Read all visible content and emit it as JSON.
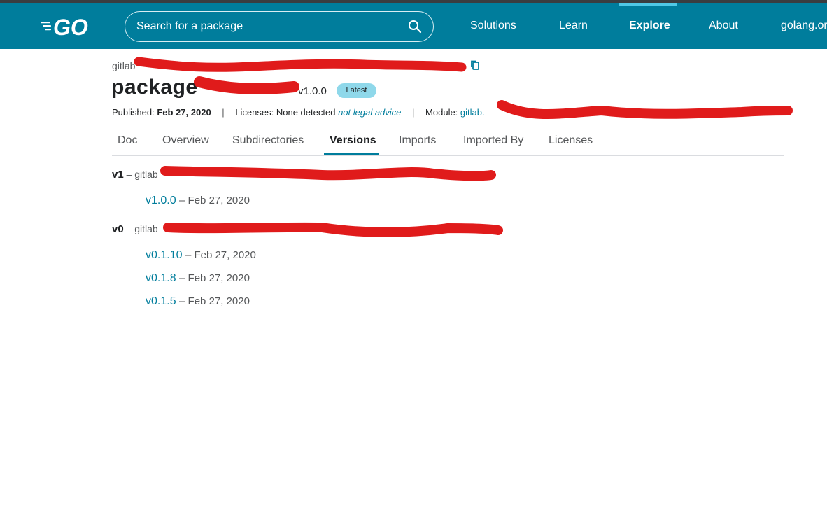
{
  "header": {
    "logo_icon": "go-logo-icon",
    "search": {
      "placeholder": "Search for a package",
      "icon": "search-icon"
    },
    "nav": [
      {
        "label": "Solutions",
        "active": false
      },
      {
        "label": "Learn",
        "active": false
      },
      {
        "label": "Explore",
        "active": true
      },
      {
        "label": "About",
        "active": false
      },
      {
        "label": "golang.or",
        "active": false
      }
    ]
  },
  "package": {
    "breadcrumb": "gitlab",
    "title_prefix": "package",
    "version": "v1.0.0",
    "badge": "Latest",
    "copy_icon": "copy-icon"
  },
  "meta": {
    "published_label": "Published:",
    "published_date": "Feb 27, 2020",
    "licenses_label": "Licenses:",
    "licenses_value": "None detected",
    "licenses_note": "not legal advice",
    "module_label": "Module:",
    "module_value": "gitlab."
  },
  "tabs": [
    {
      "label": "Doc",
      "active": false
    },
    {
      "label": "Overview",
      "active": false
    },
    {
      "label": "Subdirectories",
      "active": false
    },
    {
      "label": "Versions",
      "active": true
    },
    {
      "label": "Imports",
      "active": false
    },
    {
      "label": "Imported By",
      "active": false
    },
    {
      "label": "Licenses",
      "active": false
    }
  ],
  "versions": {
    "groups": [
      {
        "major": "v1",
        "path_prefix": "– gitlab",
        "items": [
          {
            "version": "v1.0.0",
            "date": "– Feb 27, 2020"
          }
        ]
      },
      {
        "major": "v0",
        "path_prefix": "– gitlab",
        "items": [
          {
            "version": "v0.1.10",
            "date": "– Feb 27, 2020"
          },
          {
            "version": "v0.1.8",
            "date": "– Feb 27, 2020"
          },
          {
            "version": "v0.1.5",
            "date": "– Feb 27, 2020"
          }
        ]
      }
    ]
  },
  "colors": {
    "header_bg": "#007d9c",
    "link": "#007d9c",
    "badge_bg": "#8fd8ea",
    "redaction": "#e01b1b"
  }
}
